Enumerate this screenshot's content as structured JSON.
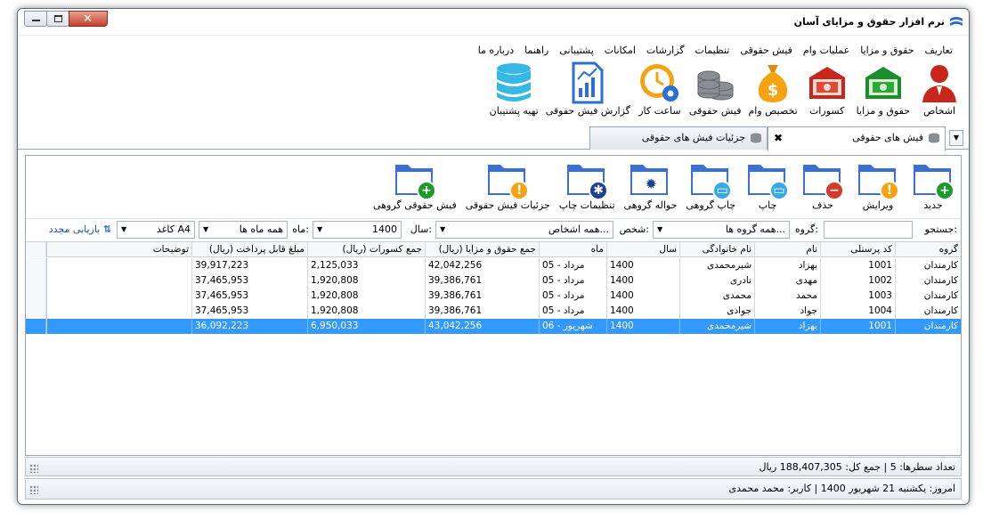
{
  "window": {
    "title": "نرم افزار حقوق و مزایای آسان"
  },
  "menu": [
    "تعاریف",
    "حقوق و مزایا",
    "عملیات وام",
    "فیش حقوقی",
    "تنظیمات",
    "گزارشات",
    "امکانات",
    "پشتیبانی",
    "راهنما",
    "درباره ما"
  ],
  "ribbon": [
    {
      "label": "اشخاص",
      "icon": "person-icon"
    },
    {
      "label": "حقوق و مزایا",
      "icon": "money-green-icon"
    },
    {
      "label": "کسورات",
      "icon": "money-red-icon"
    },
    {
      "label": "تخصیص وام",
      "icon": "money-bag-icon"
    },
    {
      "label": "فیش حقوقی",
      "icon": "coins-icon"
    },
    {
      "label": "ساعت کار",
      "icon": "clock-gear-icon"
    },
    {
      "label": "گزارش فیش حقوقی",
      "icon": "report-chart-icon"
    },
    {
      "label": "تهیه پشتیبان",
      "icon": "database-icon"
    }
  ],
  "tabs": {
    "active": "فیش های حقوقی",
    "other": "جزئیات فیش های حقوقی"
  },
  "toolbar": [
    {
      "label": "جدید",
      "badge": "plus"
    },
    {
      "label": "ویرایش",
      "badge": "warn"
    },
    {
      "label": "حذف",
      "badge": "minus"
    },
    {
      "label": "چاپ",
      "badge": "print"
    },
    {
      "label": "چاپ گروهی",
      "badge": "print"
    },
    {
      "label": "حواله گروهی",
      "badge": "gear-dark"
    },
    {
      "label": "تنظیمات چاپ",
      "badge": "gear"
    },
    {
      "label": "جزئیات فیش حقوقی",
      "badge": "warn"
    },
    {
      "label": "فیش حقوقی گروهی",
      "badge": "plus"
    }
  ],
  "filters": {
    "search_label": "جستجو:",
    "search_value": "",
    "group_label": "گروه:",
    "group_value": "همه گروه ها...",
    "person_label": "شخص:",
    "person_value": "همه اشخاص...",
    "year_label": "سال:",
    "year_value": "1400",
    "month_label": "ماه:",
    "month_value": "همه ماه ها",
    "paper_value": "کاغذ A4",
    "reload_label": "بازیابی مجدد"
  },
  "table": {
    "columns": [
      "گروه",
      "کد پرسنلی",
      "نام",
      "نام خانوادگی",
      "سال",
      "ماه",
      "جمع حقوق و مزایا (ریال)",
      "جمع کسورات (ریال)",
      "مبلغ قابل پرداخت (ریال)",
      "توضیحات"
    ],
    "rows": [
      [
        "کارمندان",
        "1001",
        "بهزاد",
        "شیرمحمدی",
        "1400",
        "05 - مرداد",
        "42,042,256",
        "2,125,033",
        "39,917,223",
        ""
      ],
      [
        "کارمندان",
        "1002",
        "مهدی",
        "نادری",
        "1400",
        "05 - مرداد",
        "39,386,761",
        "1,920,808",
        "37,465,953",
        ""
      ],
      [
        "کارمندان",
        "1003",
        "محمد",
        "محمدی",
        "1400",
        "05 - مرداد",
        "39,386,761",
        "1,920,808",
        "37,465,953",
        ""
      ],
      [
        "کارمندان",
        "1004",
        "جواد",
        "جوادی",
        "1400",
        "05 - مرداد",
        "39,386,761",
        "1,920,808",
        "37,465,953",
        ""
      ],
      [
        "کارمندان",
        "1001",
        "بهزاد",
        "شیرمحمدی",
        "1400",
        "06 - شهریور",
        "43,042,256",
        "6,950,033",
        "36,092,223",
        ""
      ]
    ],
    "selected_row": 4
  },
  "status": {
    "rows_count_text": "تعداد سطرها:  5  |  جمع کل: 188,407,305 ریال",
    "today_text": "امروز: یکشنبه 21 شهریور 1400  |  کاربر: محمد محمدی"
  },
  "colors": {
    "accent": "#3399ff",
    "folder": "#3b6fd8",
    "green": "#1a9b2a",
    "orange": "#f5a311",
    "red": "#d63a2a"
  }
}
